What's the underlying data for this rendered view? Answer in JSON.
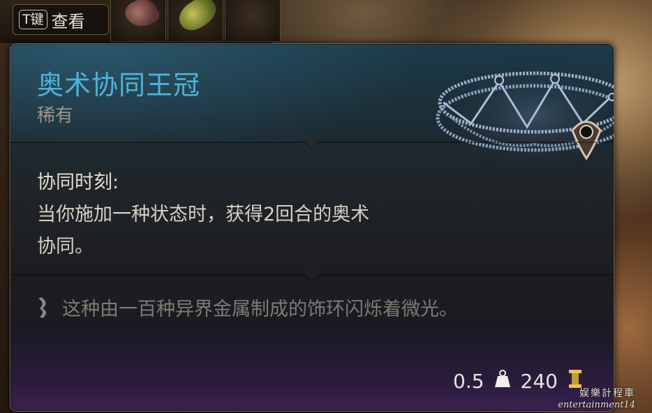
{
  "hotbar": {
    "key_label": "T键",
    "action_label": "查看",
    "slots": [
      {
        "icon": "tentacle-item-icon"
      },
      {
        "icon": "food-item-icon"
      }
    ]
  },
  "item": {
    "name": "奥术协同王冠",
    "rarity": "稀有",
    "image_icon": "circlet-icon",
    "ability": {
      "heading": "协同时刻:",
      "line1": "当你施加一种状态时，获得2回合的奥术",
      "line2": "协同。"
    },
    "flavor_icon": "quill-icon",
    "flavor": "这种由一百种异界金属制成的饰环闪烁着微光。",
    "weight": "0.5",
    "weight_icon": "weight-icon",
    "value": "240",
    "value_icon": "coin-icon"
  },
  "colors": {
    "title": "#4fb3d6",
    "rarity": "#9a968e",
    "body_text": "#d7d0c4",
    "flavor_text": "#7f7b74",
    "coin": "#e7c35a"
  },
  "watermark": {
    "line1": "娱樂計程車",
    "line2": "entertainment14"
  }
}
